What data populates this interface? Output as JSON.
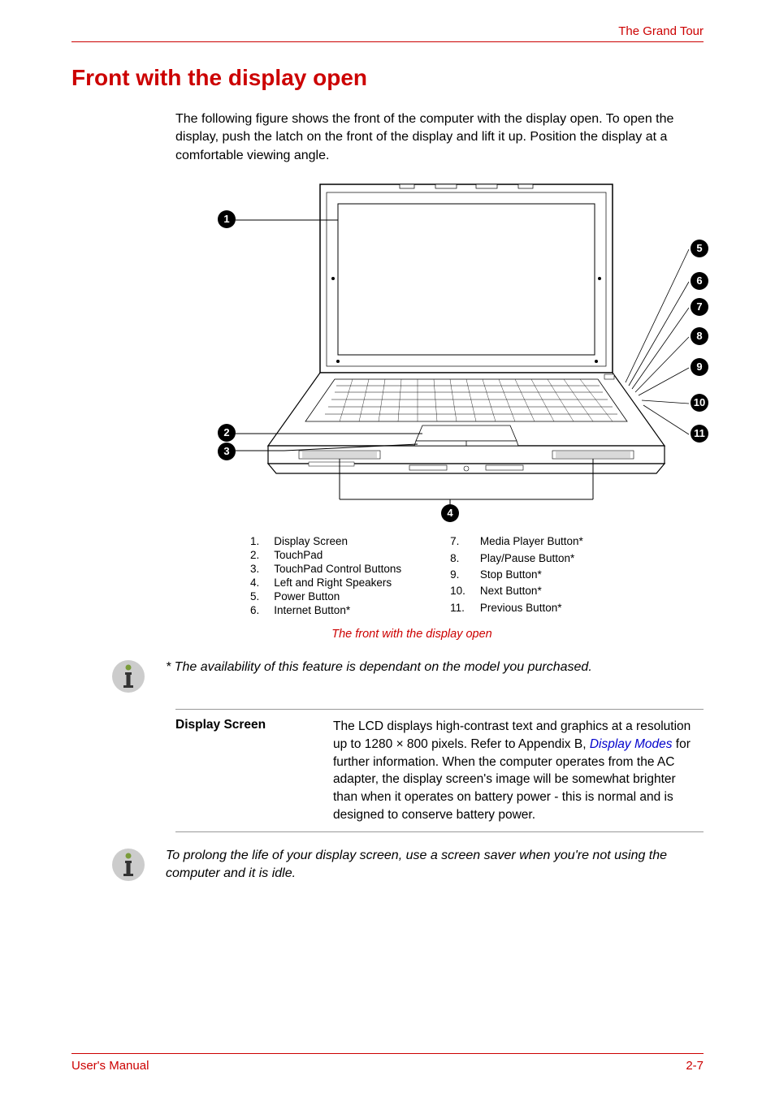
{
  "header": {
    "section_title": "The Grand Tour"
  },
  "heading": "Front with the display open",
  "intro": "The following figure shows the front of the computer with the display open. To open the display, push the latch on the front of the display and lift it up. Position the display at a comfortable viewing angle.",
  "figure": {
    "callouts": [
      "1",
      "2",
      "3",
      "4",
      "5",
      "6",
      "7",
      "8",
      "9",
      "10",
      "11"
    ],
    "legend_left": [
      {
        "num": "1.",
        "text": "Display Screen"
      },
      {
        "num": "2.",
        "text": "TouchPad"
      },
      {
        "num": "3.",
        "text": "TouchPad Control Buttons"
      },
      {
        "num": "4.",
        "text": "Left and Right Speakers"
      },
      {
        "num": "5.",
        "text": "Power Button"
      },
      {
        "num": "6.",
        "text": "Internet Button*"
      }
    ],
    "legend_right": [
      {
        "num": "7.",
        "text": "Media Player Button*"
      },
      {
        "num": "8.",
        "text": "Play/Pause Button*"
      },
      {
        "num": "9.",
        "text": "Stop Button*"
      },
      {
        "num": "10.",
        "text": "Next Button*"
      },
      {
        "num": "11.",
        "text": "Previous Button*"
      }
    ],
    "caption": "The front with the display open"
  },
  "note1": "* The availability of this feature is dependant on the model you purchased.",
  "definition": {
    "term": "Display Screen",
    "desc_before_link": "The LCD displays high-contrast text and graphics at a resolution up to 1280 × 800 pixels. Refer to Appendix B, ",
    "link": "Display Modes",
    "desc_after_link": " for further information. When the computer operates from the AC adapter, the display screen's image will be somewhat brighter than when it operates on battery power - this is normal and is designed to conserve battery power."
  },
  "note2": "To prolong the life of your display screen, use a screen saver when you're not using the computer and it is idle.",
  "footer": {
    "left": "User's Manual",
    "right": "2-7"
  }
}
